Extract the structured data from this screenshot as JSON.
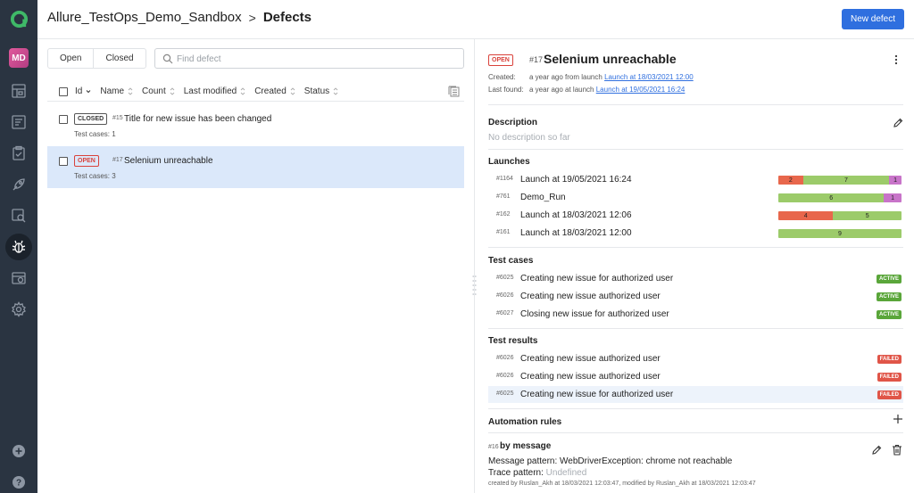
{
  "sidebar": {
    "avatar_initials": "MD",
    "items": [
      "dashboard-icon",
      "launches-icon",
      "test-cases-icon",
      "jobs-icon",
      "analytics-icon",
      "defects-icon",
      "environments-icon",
      "settings-icon"
    ],
    "bottom": [
      "add-icon",
      "help-icon"
    ]
  },
  "header": {
    "project": "Allure_TestOps_Demo_Sandbox",
    "separator": ">",
    "page": "Defects",
    "new_defect_label": "New defect"
  },
  "left": {
    "tabs": [
      "Open",
      "Closed"
    ],
    "search_placeholder": "Find defect",
    "columns": [
      "Id",
      "Name",
      "Count",
      "Last modified",
      "Created",
      "Status"
    ],
    "rows": [
      {
        "badge": "CLOSED",
        "id": "#15",
        "title": "Title for new issue has been changed",
        "sub": "Test cases: 1"
      },
      {
        "badge": "OPEN",
        "id": "#17",
        "title": "Selenium unreachable",
        "sub": "Test cases: 3"
      }
    ]
  },
  "detail": {
    "badge": "OPEN",
    "id": "#17",
    "title": "Selenium unreachable",
    "created_label": "Created:",
    "created_text": "a year ago from launch",
    "created_link": "Launch at 18/03/2021 12:00",
    "lastfound_label": "Last found:",
    "lastfound_text": "a year ago at launch",
    "lastfound_link": "Launch at 19/05/2021 16:24",
    "description_title": "Description",
    "description_empty": "No description so far",
    "launches_title": "Launches",
    "launches": [
      {
        "id": "#1164",
        "name": "Launch at 19/05/2021 16:24",
        "segments": [
          {
            "v": 2,
            "c": "#e8674c"
          },
          {
            "v": 7,
            "c": "#9ccb6a"
          },
          {
            "v": 1,
            "c": "#c874c9"
          }
        ]
      },
      {
        "id": "#761",
        "name": "Demo_Run",
        "segments": [
          {
            "v": 6,
            "c": "#9ccb6a"
          },
          {
            "v": 1,
            "c": "#c874c9"
          }
        ]
      },
      {
        "id": "#162",
        "name": "Launch at 18/03/2021 12:06",
        "segments": [
          {
            "v": 4,
            "c": "#e8674c"
          },
          {
            "v": 5,
            "c": "#9ccb6a"
          }
        ]
      },
      {
        "id": "#161",
        "name": "Launch at 18/03/2021 12:00",
        "segments": [
          {
            "v": 9,
            "c": "#9ccb6a"
          }
        ]
      }
    ],
    "testcases_title": "Test cases",
    "testcases": [
      {
        "id": "#6025",
        "name": "Creating new issue for authorized user",
        "status": "ACTIVE"
      },
      {
        "id": "#6026",
        "name": "Creating new issue authorized user",
        "status": "ACTIVE"
      },
      {
        "id": "#6027",
        "name": "Closing new issue for authorized user",
        "status": "ACTIVE"
      }
    ],
    "results_title": "Test results",
    "results": [
      {
        "id": "#6026",
        "name": "Creating new issue authorized user",
        "status": "FAILED"
      },
      {
        "id": "#6026",
        "name": "Creating new issue authorized user",
        "status": "FAILED"
      },
      {
        "id": "#6025",
        "name": "Creating new issue for authorized user",
        "status": "FAILED"
      }
    ],
    "automation_title": "Automation rules",
    "rule": {
      "id": "#16",
      "title": "by message",
      "message_label": "Message pattern:",
      "message_value": "WebDriverException: chrome not reachable",
      "trace_label": "Trace pattern:",
      "trace_value": "Undefined",
      "footer": "created by Ruslan_Akh at 18/03/2021 12:03:47, modified by Ruslan_Akh at 18/03/2021 12:03:47"
    }
  }
}
